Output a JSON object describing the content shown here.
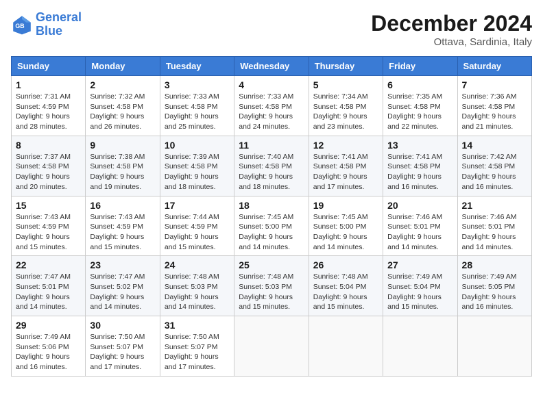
{
  "logo": {
    "line1": "General",
    "line2": "Blue"
  },
  "title": "December 2024",
  "location": "Ottava, Sardinia, Italy",
  "weekdays": [
    "Sunday",
    "Monday",
    "Tuesday",
    "Wednesday",
    "Thursday",
    "Friday",
    "Saturday"
  ],
  "weeks": [
    [
      {
        "day": "1",
        "sunrise": "7:31 AM",
        "sunset": "4:59 PM",
        "daylight": "9 hours and 28 minutes."
      },
      {
        "day": "2",
        "sunrise": "7:32 AM",
        "sunset": "4:58 PM",
        "daylight": "9 hours and 26 minutes."
      },
      {
        "day": "3",
        "sunrise": "7:33 AM",
        "sunset": "4:58 PM",
        "daylight": "9 hours and 25 minutes."
      },
      {
        "day": "4",
        "sunrise": "7:33 AM",
        "sunset": "4:58 PM",
        "daylight": "9 hours and 24 minutes."
      },
      {
        "day": "5",
        "sunrise": "7:34 AM",
        "sunset": "4:58 PM",
        "daylight": "9 hours and 23 minutes."
      },
      {
        "day": "6",
        "sunrise": "7:35 AM",
        "sunset": "4:58 PM",
        "daylight": "9 hours and 22 minutes."
      },
      {
        "day": "7",
        "sunrise": "7:36 AM",
        "sunset": "4:58 PM",
        "daylight": "9 hours and 21 minutes."
      }
    ],
    [
      {
        "day": "8",
        "sunrise": "7:37 AM",
        "sunset": "4:58 PM",
        "daylight": "9 hours and 20 minutes."
      },
      {
        "day": "9",
        "sunrise": "7:38 AM",
        "sunset": "4:58 PM",
        "daylight": "9 hours and 19 minutes."
      },
      {
        "day": "10",
        "sunrise": "7:39 AM",
        "sunset": "4:58 PM",
        "daylight": "9 hours and 18 minutes."
      },
      {
        "day": "11",
        "sunrise": "7:40 AM",
        "sunset": "4:58 PM",
        "daylight": "9 hours and 18 minutes."
      },
      {
        "day": "12",
        "sunrise": "7:41 AM",
        "sunset": "4:58 PM",
        "daylight": "9 hours and 17 minutes."
      },
      {
        "day": "13",
        "sunrise": "7:41 AM",
        "sunset": "4:58 PM",
        "daylight": "9 hours and 16 minutes."
      },
      {
        "day": "14",
        "sunrise": "7:42 AM",
        "sunset": "4:58 PM",
        "daylight": "9 hours and 16 minutes."
      }
    ],
    [
      {
        "day": "15",
        "sunrise": "7:43 AM",
        "sunset": "4:59 PM",
        "daylight": "9 hours and 15 minutes."
      },
      {
        "day": "16",
        "sunrise": "7:43 AM",
        "sunset": "4:59 PM",
        "daylight": "9 hours and 15 minutes."
      },
      {
        "day": "17",
        "sunrise": "7:44 AM",
        "sunset": "4:59 PM",
        "daylight": "9 hours and 15 minutes."
      },
      {
        "day": "18",
        "sunrise": "7:45 AM",
        "sunset": "5:00 PM",
        "daylight": "9 hours and 14 minutes."
      },
      {
        "day": "19",
        "sunrise": "7:45 AM",
        "sunset": "5:00 PM",
        "daylight": "9 hours and 14 minutes."
      },
      {
        "day": "20",
        "sunrise": "7:46 AM",
        "sunset": "5:01 PM",
        "daylight": "9 hours and 14 minutes."
      },
      {
        "day": "21",
        "sunrise": "7:46 AM",
        "sunset": "5:01 PM",
        "daylight": "9 hours and 14 minutes."
      }
    ],
    [
      {
        "day": "22",
        "sunrise": "7:47 AM",
        "sunset": "5:01 PM",
        "daylight": "9 hours and 14 minutes."
      },
      {
        "day": "23",
        "sunrise": "7:47 AM",
        "sunset": "5:02 PM",
        "daylight": "9 hours and 14 minutes."
      },
      {
        "day": "24",
        "sunrise": "7:48 AM",
        "sunset": "5:03 PM",
        "daylight": "9 hours and 14 minutes."
      },
      {
        "day": "25",
        "sunrise": "7:48 AM",
        "sunset": "5:03 PM",
        "daylight": "9 hours and 15 minutes."
      },
      {
        "day": "26",
        "sunrise": "7:48 AM",
        "sunset": "5:04 PM",
        "daylight": "9 hours and 15 minutes."
      },
      {
        "day": "27",
        "sunrise": "7:49 AM",
        "sunset": "5:04 PM",
        "daylight": "9 hours and 15 minutes."
      },
      {
        "day": "28",
        "sunrise": "7:49 AM",
        "sunset": "5:05 PM",
        "daylight": "9 hours and 16 minutes."
      }
    ],
    [
      {
        "day": "29",
        "sunrise": "7:49 AM",
        "sunset": "5:06 PM",
        "daylight": "9 hours and 16 minutes."
      },
      {
        "day": "30",
        "sunrise": "7:50 AM",
        "sunset": "5:07 PM",
        "daylight": "9 hours and 17 minutes."
      },
      {
        "day": "31",
        "sunrise": "7:50 AM",
        "sunset": "5:07 PM",
        "daylight": "9 hours and 17 minutes."
      },
      null,
      null,
      null,
      null
    ]
  ]
}
